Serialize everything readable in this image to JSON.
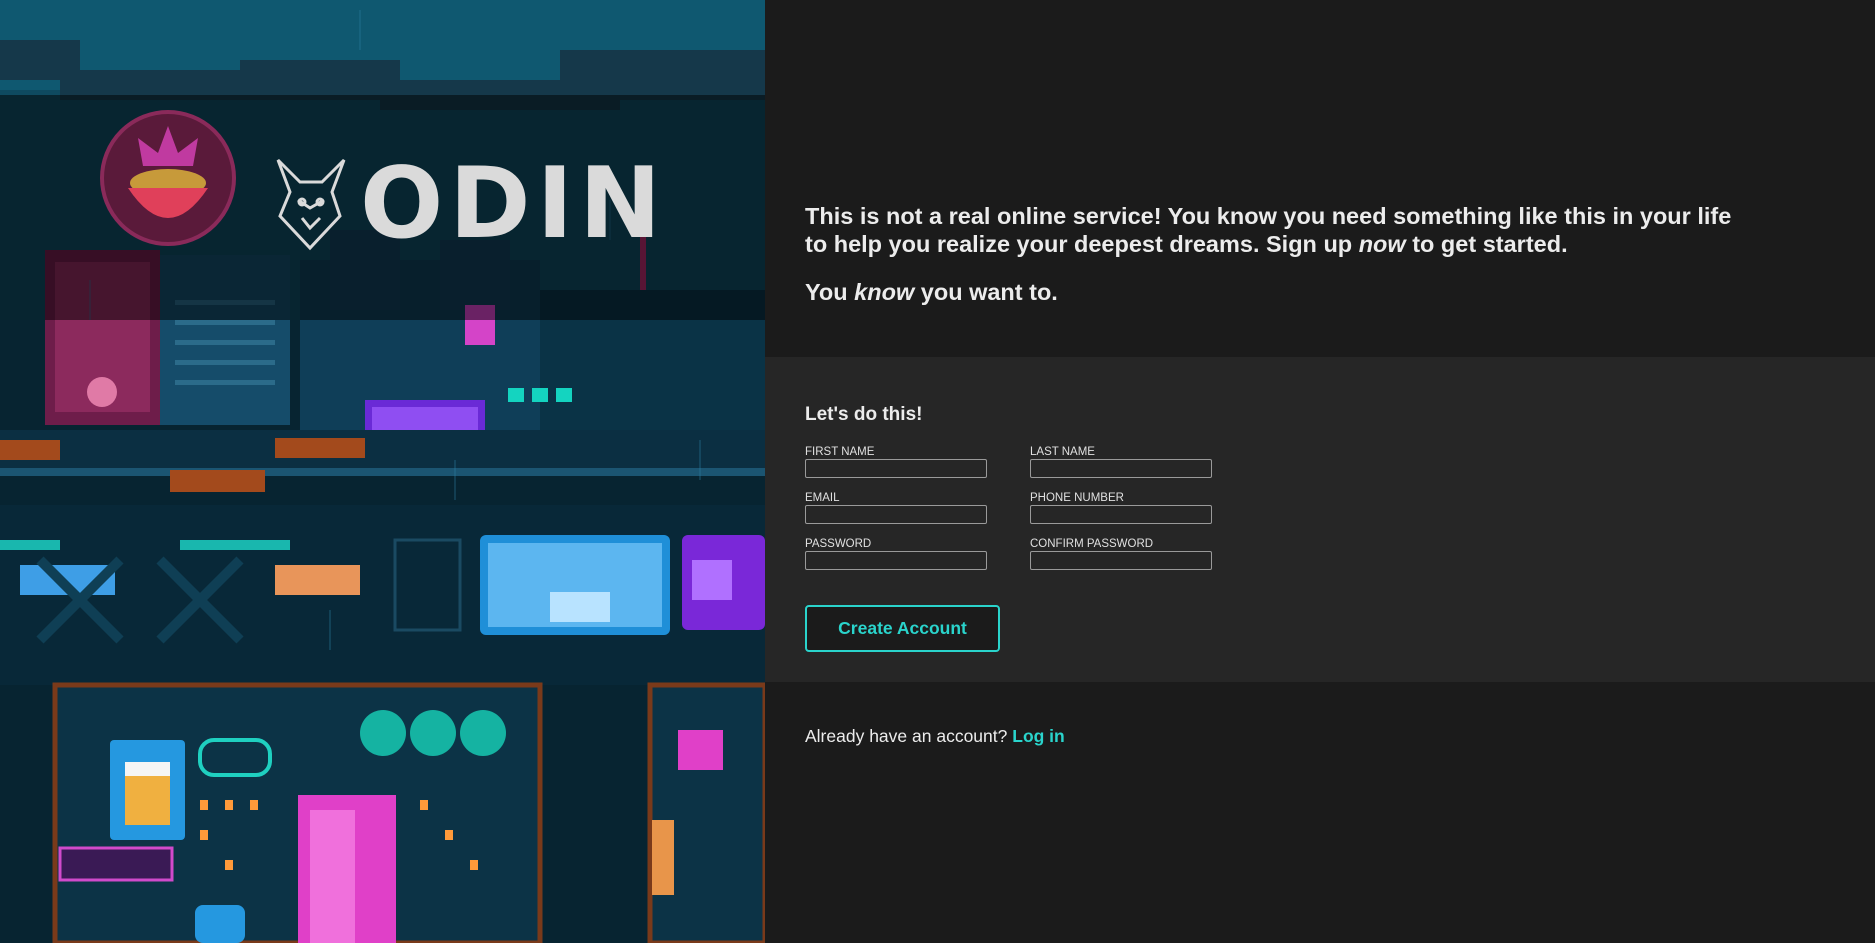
{
  "brand": {
    "logo_text": "ODIN"
  },
  "intro": {
    "line1_pre": "This is not a real online service! You know you need something like this in your life to help you realize your deepest dreams. Sign up ",
    "line1_em": "now",
    "line1_post": " to get started.",
    "line2_pre": "You ",
    "line2_em": "know",
    "line2_post": " you want to."
  },
  "form": {
    "title": "Let's do this!",
    "fields": {
      "first_name": "FIRST NAME",
      "last_name": "LAST NAME",
      "email": "EMAIL",
      "phone": "PHONE NUMBER",
      "password": "PASSWORD",
      "confirm_password": "CONFIRM PASSWORD"
    },
    "submit_label": "Create Account"
  },
  "footer": {
    "prompt": "Already have an account?",
    "login_label": "Log in"
  },
  "colors": {
    "accent": "#2ad4cc",
    "background": "#1b1b1b",
    "form_band": "#262626"
  }
}
